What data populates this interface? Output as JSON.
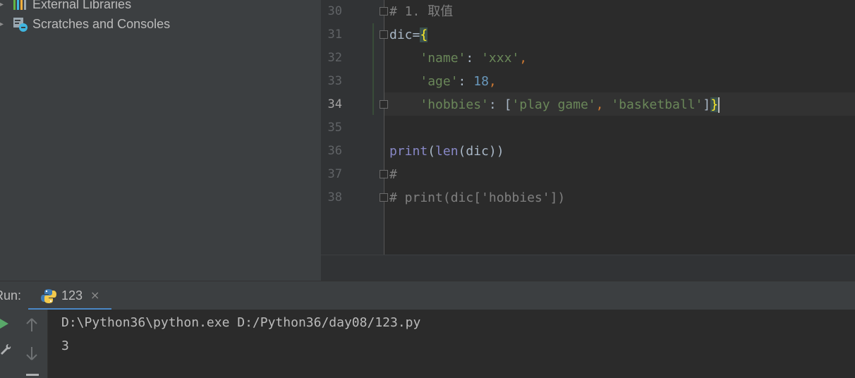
{
  "project_tree": {
    "items": [
      {
        "label": "External Libraries",
        "icon": "library-icon"
      },
      {
        "label": "Scratches and Consoles",
        "icon": "scratches-icon"
      }
    ]
  },
  "editor": {
    "current_line": "34",
    "line_numbers": [
      "30",
      "31",
      "32",
      "33",
      "34",
      "35",
      "36",
      "37",
      "38"
    ],
    "lines": {
      "l30": {
        "hash": "#",
        "comment": " 1. 取值"
      },
      "l31": {
        "a": "dic=",
        "b": "{"
      },
      "l32": {
        "indent": "    ",
        "key": "'name'",
        "colon": ": ",
        "val": "'xxx'",
        "comma": ","
      },
      "l33": {
        "indent": "    ",
        "key": "'age'",
        "colon": ": ",
        "val": "18",
        "comma": ","
      },
      "l34": {
        "indent": "    ",
        "key": "'hobbies'",
        "colon": ": [",
        "v1": "'play game'",
        "sep": ", ",
        "v2": "'basketball'",
        "close": "]",
        "brace": "}"
      },
      "l36": {
        "fn1": "print",
        "p1": "(",
        "fn2": "len",
        "rest": "(dic))"
      },
      "l37": {
        "text": "#"
      },
      "l38": {
        "text": "# print(dic['hobbies'])"
      }
    }
  },
  "run": {
    "label": "Run:",
    "tab": {
      "label": "123",
      "close": "×"
    },
    "console": [
      "D:\\Python36\\python.exe D:/Python36/day08/123.py",
      "3"
    ]
  },
  "colors": {
    "editor_bg": "#2b2b2b",
    "panel_bg": "#3c3f41",
    "string": "#6a8759",
    "number": "#6897bb",
    "keyword": "#cc7832",
    "builtin": "#8888c6",
    "comment": "#808080",
    "matched_brace": "#ffef28"
  }
}
